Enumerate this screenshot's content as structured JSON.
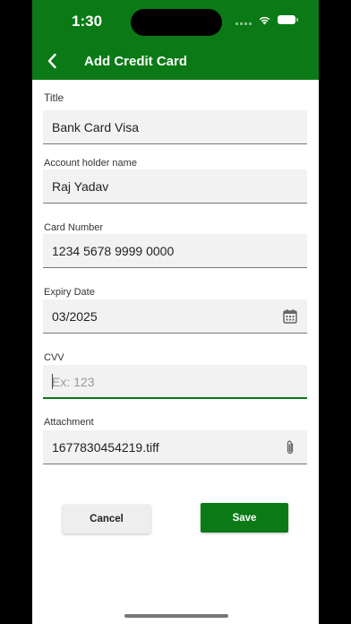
{
  "status_bar": {
    "time": "1:30"
  },
  "header": {
    "title": "Add Credit Card"
  },
  "form": {
    "title": {
      "label": "Title",
      "value": "Bank Card Visa"
    },
    "holder": {
      "label": "Account holder name",
      "value": "Raj Yadav"
    },
    "card_number": {
      "label": "Card Number",
      "value": "1234 5678 9999 0000"
    },
    "expiry": {
      "label": "Expiry Date",
      "value": "03/2025",
      "icon": "calendar-icon"
    },
    "cvv": {
      "label": "CVV",
      "placeholder": "Ex: 123"
    },
    "attachment": {
      "label": "Attachment",
      "value": "1677830454219.tiff",
      "icon": "paperclip-icon"
    }
  },
  "actions": {
    "cancel_label": "Cancel",
    "save_label": "Save"
  },
  "colors": {
    "primary": "#0b7a16",
    "field_bg": "#f2f2f2",
    "cancel_bg": "#eeeeee"
  }
}
